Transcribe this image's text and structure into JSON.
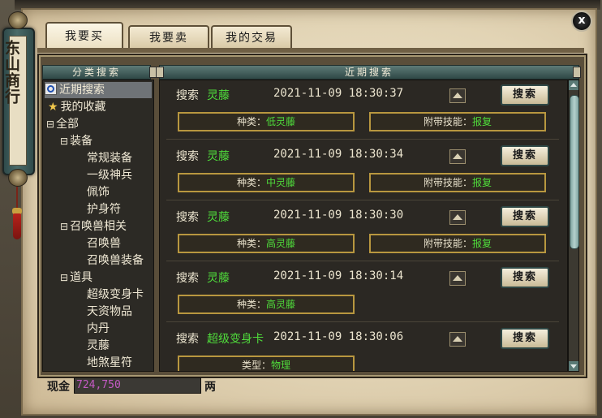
{
  "window": {
    "title": "东山商行",
    "close_label": "x"
  },
  "tabs": [
    {
      "label": "我要买",
      "active": true
    },
    {
      "label": "我要卖",
      "active": false
    },
    {
      "label": "我的交易",
      "active": false
    }
  ],
  "category_panel": {
    "header": "分类搜索",
    "items": [
      {
        "label": "近期搜索",
        "icon": "search-icon",
        "selected": true
      },
      {
        "label": "我的收藏",
        "icon": "star-icon"
      },
      {
        "label": "全部",
        "sign": "⊟"
      },
      {
        "label": "装备",
        "sign": "⊟"
      },
      {
        "label": "常规装备"
      },
      {
        "label": "一级神兵"
      },
      {
        "label": "佩饰"
      },
      {
        "label": "护身符"
      },
      {
        "label": "召唤兽相关",
        "sign": "⊟"
      },
      {
        "label": "召唤兽"
      },
      {
        "label": "召唤兽装备"
      },
      {
        "label": "道具",
        "sign": "⊟"
      },
      {
        "label": "超级变身卡"
      },
      {
        "label": "天资物品"
      },
      {
        "label": "内丹"
      },
      {
        "label": "灵藤"
      },
      {
        "label": "地煞星符"
      }
    ]
  },
  "recent_panel": {
    "header": "近期搜索",
    "search_label": "搜索",
    "button_label": "搜索",
    "records": [
      {
        "item": "灵藤",
        "time": "2021-11-09 18:30:37",
        "f1_label": "种类：",
        "f1_value": "低灵藤",
        "f2_label": "附带技能：",
        "f2_value": "报复"
      },
      {
        "item": "灵藤",
        "time": "2021-11-09 18:30:34",
        "f1_label": "种类：",
        "f1_value": "中灵藤",
        "f2_label": "附带技能：",
        "f2_value": "报复"
      },
      {
        "item": "灵藤",
        "time": "2021-11-09 18:30:30",
        "f1_label": "种类：",
        "f1_value": "高灵藤",
        "f2_label": "附带技能：",
        "f2_value": "报复"
      },
      {
        "item": "灵藤",
        "time": "2021-11-09 18:30:14",
        "f1_label": "种类：",
        "f1_value": "高灵藤"
      },
      {
        "item": "超级变身卡",
        "time": "2021-11-09 18:30:06",
        "f1_label": "类型：",
        "f1_value": "物理"
      }
    ]
  },
  "footer": {
    "cash_label": "现金",
    "cash_value": "724,750",
    "cash_unit": "两"
  },
  "colors": {
    "item_green": "#4fdc3b",
    "cash_magenta": "#c45ac4",
    "header_teal": "#2f4846"
  }
}
